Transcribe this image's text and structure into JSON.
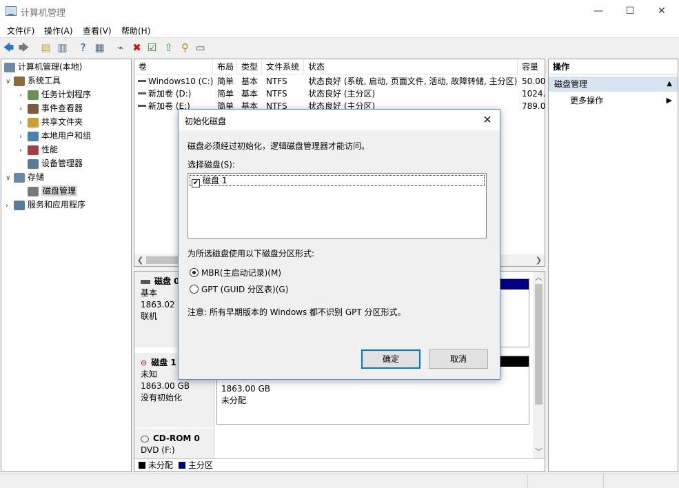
{
  "window": {
    "title": "计算机管理",
    "minimize": "—",
    "maximize": "☐",
    "close": "✕"
  },
  "menu": [
    "文件(F)",
    "操作(A)",
    "查看(V)",
    "帮助(H)"
  ],
  "toolbar_icons": [
    {
      "name": "back-arrow-icon",
      "glyph": "🡄",
      "color": "#2b79c2"
    },
    {
      "name": "forward-arrow-icon",
      "glyph": "🡆",
      "color": "#777777"
    },
    {
      "name": "up-folder-icon",
      "glyph": "▤",
      "color": "#c8a032"
    },
    {
      "name": "show-hide-tree-icon",
      "glyph": "▥",
      "color": "#4a6b8a"
    },
    {
      "name": "help-icon",
      "glyph": "?",
      "color": "#1f4fa0"
    },
    {
      "name": "properties-pane-icon",
      "glyph": "▦",
      "color": "#4a6b8a"
    },
    {
      "name": "connect-icon",
      "glyph": "⌁",
      "color": "#555555"
    },
    {
      "name": "delete-icon",
      "glyph": "✖",
      "color": "#d01010"
    },
    {
      "name": "check-icon",
      "glyph": "☑",
      "color": "#3a7a3a"
    },
    {
      "name": "import-icon",
      "glyph": "⇧",
      "color": "#3a9a3a"
    },
    {
      "name": "search-icon",
      "glyph": "⚲",
      "color": "#b08a20"
    },
    {
      "name": "view-list-icon",
      "glyph": "▭",
      "color": "#555555"
    }
  ],
  "tree": {
    "root": "计算机管理(本地)",
    "items": [
      {
        "label": "系统工具",
        "expander": "∨",
        "color": "#8a6d3b"
      },
      {
        "label": "任务计划程序",
        "expander": "›",
        "color": "#6b8e5a"
      },
      {
        "label": "事件查看器",
        "expander": "›",
        "color": "#7a5a3a"
      },
      {
        "label": "共享文件夹",
        "expander": "›",
        "color": "#c8a032"
      },
      {
        "label": "本地用户和组",
        "expander": "›",
        "color": "#4a7fb0"
      },
      {
        "label": "性能",
        "expander": "›",
        "color": "#a04040"
      },
      {
        "label": "设备管理器",
        "expander": "",
        "color": "#5a7a9a"
      },
      {
        "label": "存储",
        "expander": "∨",
        "color": "#6a8aa8"
      },
      {
        "label": "磁盘管理",
        "expander": "",
        "color": "#7a7a7a"
      },
      {
        "label": "服务和应用程序",
        "expander": "›",
        "color": "#5a7a9a"
      }
    ]
  },
  "volumes": {
    "columns": [
      "卷",
      "布局",
      "类型",
      "文件系统",
      "状态",
      "容量"
    ],
    "rows": [
      [
        "Windows10 (C:)",
        "简单",
        "基本",
        "NTFS",
        "状态良好 (系统, 启动, 页面文件, 活动, 故障转储, 主分区)",
        "50.00"
      ],
      [
        "新加卷 (D:)",
        "简单",
        "基本",
        "NTFS",
        "状态良好 (主分区)",
        "1024."
      ],
      [
        "新加卷 (E:)",
        "简单",
        "基本",
        "NTFS",
        "状态良好 (主分区)",
        "789.0"
      ]
    ]
  },
  "disks": [
    {
      "name": "磁盘 0",
      "type": "基本",
      "size": "1863.02 GB",
      "status": "联机",
      "bar_color": "#000080"
    },
    {
      "name": "磁盘 1",
      "type": "未知",
      "size": "1863.00 GB",
      "status": "没有初始化",
      "part_size": "1863.00 GB",
      "part_status": "未分配",
      "bar_color": "#000000"
    },
    {
      "name": "CD-ROM 0",
      "type": "DVD (F:)"
    }
  ],
  "legend": [
    {
      "label": "未分配",
      "color": "#000000"
    },
    {
      "label": "主分区",
      "color": "#000080"
    }
  ],
  "actions": {
    "header": "操作",
    "section": "磁盘管理",
    "more": "更多操作"
  },
  "dialog": {
    "title": "初始化磁盘",
    "message": "磁盘必须经过初始化，逻辑磁盘管理器才能访问。",
    "select_label": "选择磁盘(S):",
    "disk_item": "磁盘 1",
    "partition_label": "为所选磁盘使用以下磁盘分区形式:",
    "option_mbr": "MBR(主启动记录)(M)",
    "option_gpt": "GPT (GUID 分区表)(G)",
    "note": "注意: 所有早期版本的 Windows 都不识别 GPT 分区形式。",
    "ok": "确定",
    "cancel": "取消"
  }
}
